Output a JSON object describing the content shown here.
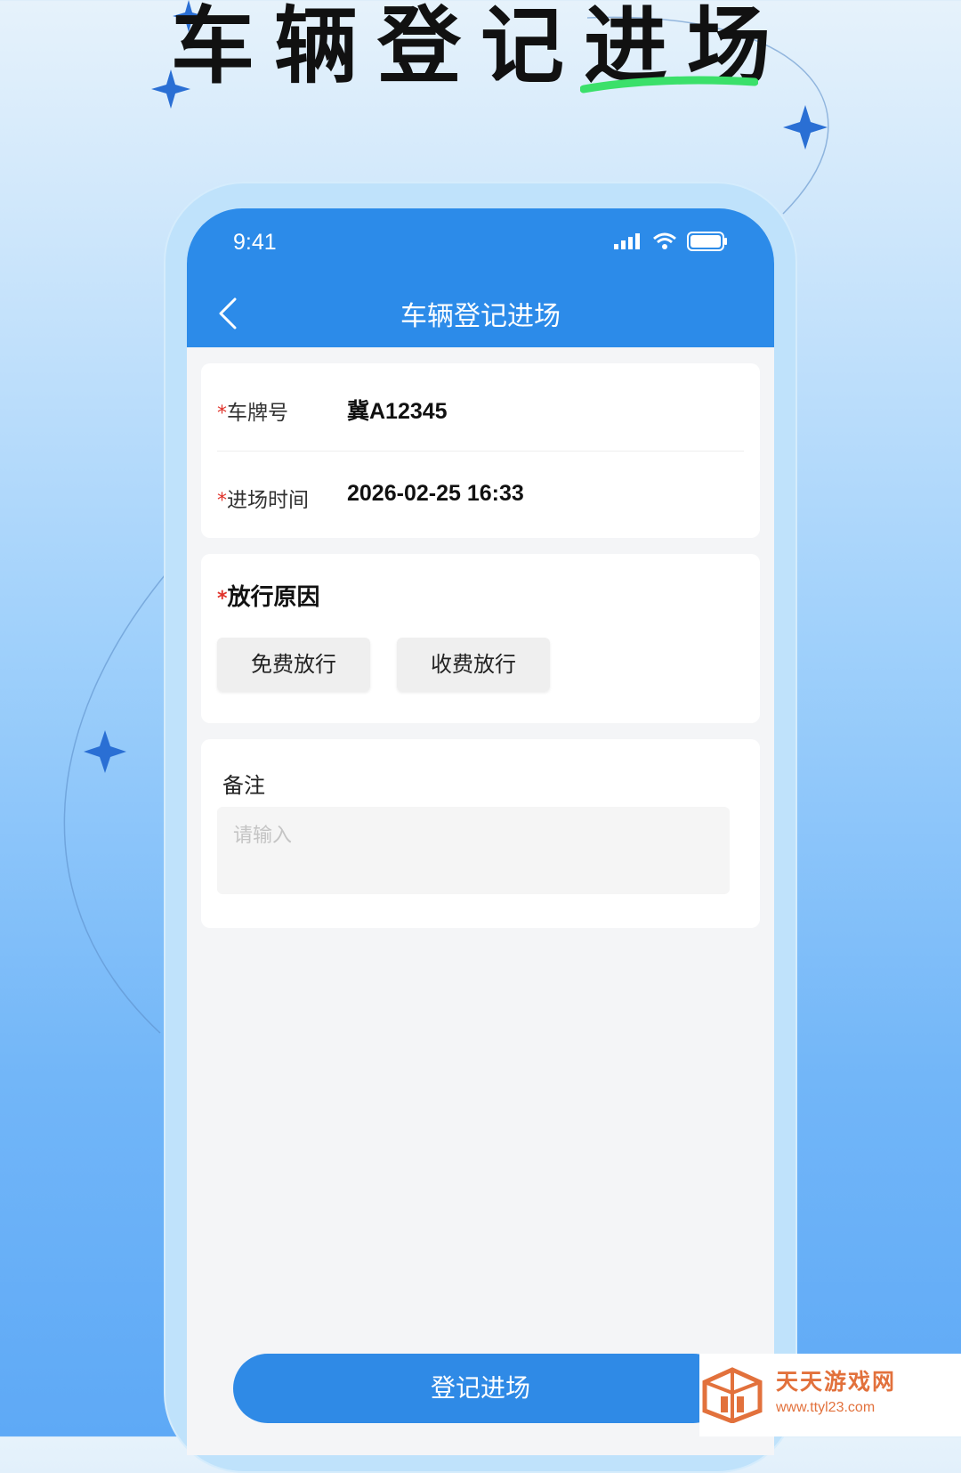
{
  "promo": {
    "headline": "车辆登记进场"
  },
  "status_bar": {
    "time": "9:41"
  },
  "nav": {
    "title": "车辆登记进场"
  },
  "form": {
    "required_mark": "*",
    "plate": {
      "label": "车牌号",
      "value": "冀A12345"
    },
    "entry_time": {
      "label": "进场时间",
      "value": "2026-02-25 16:33"
    }
  },
  "release_reason": {
    "title": "放行原因",
    "options": [
      "免费放行",
      "收费放行"
    ]
  },
  "remark": {
    "label": "备注",
    "placeholder": "请输入"
  },
  "submit": {
    "label": "登记进场"
  },
  "watermark": {
    "name": "天天游戏网",
    "url": "www.ttyl23.com"
  },
  "colors": {
    "primary": "#2c8be9",
    "required": "#e0322a",
    "highlight": "#3be06a",
    "watermark": "#e2713c"
  }
}
